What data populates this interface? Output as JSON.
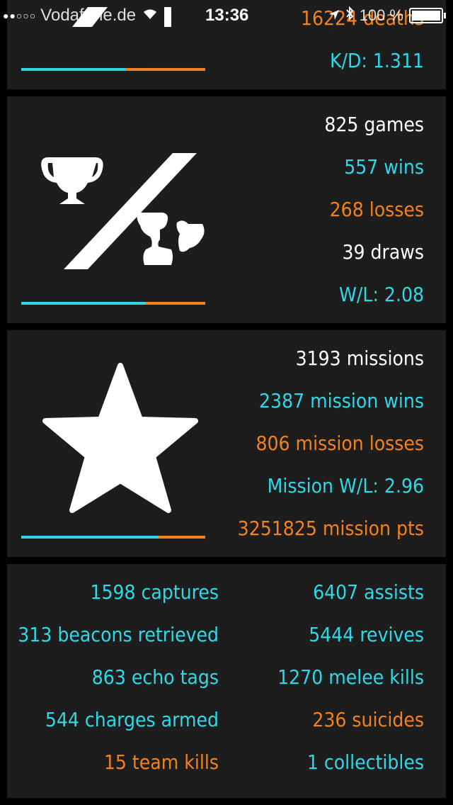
{
  "status_bar": {
    "signal_dots": "●●○○○",
    "carrier": "Vodafone.de",
    "time": "13:36",
    "battery": "100 %"
  },
  "kills_card": {
    "deaths": "16224 deaths",
    "kd": "K/D: 1.311",
    "ratio_cyan_fraction": 0.567
  },
  "games_card": {
    "icon": "trophy-split-icon",
    "games": "825 games",
    "wins": "557 wins",
    "losses": "268 losses",
    "draws": "39 draws",
    "wl": "W/L: 2.08",
    "ratio_cyan_fraction": 0.675
  },
  "missions_card": {
    "icon": "star-icon",
    "missions": "3193 missions",
    "mission_wins": "2387 mission wins",
    "mission_losses": "806 mission losses",
    "mission_wl": "Mission W/L: 2.96",
    "mission_pts": "3251825 mission pts",
    "ratio_cyan_fraction": 0.748
  },
  "misc_card": {
    "left": [
      {
        "text": "1598 captures",
        "color": "cyan"
      },
      {
        "text": "313 beacons retrieved",
        "color": "cyan"
      },
      {
        "text": "863 echo tags",
        "color": "cyan"
      },
      {
        "text": "544 charges armed",
        "color": "cyan"
      },
      {
        "text": "15 team kills",
        "color": "orange"
      }
    ],
    "right": [
      {
        "text": "6407 assists",
        "color": "cyan"
      },
      {
        "text": "5444 revives",
        "color": "cyan"
      },
      {
        "text": "1270 melee kills",
        "color": "cyan"
      },
      {
        "text": "236 suicides",
        "color": "orange"
      },
      {
        "text": "1 collectibles",
        "color": "cyan"
      }
    ]
  },
  "colors": {
    "cyan": "#2fd8e6",
    "orange": "#f2811e",
    "white": "#ffffff",
    "card_bg": "#1d1d1d"
  }
}
